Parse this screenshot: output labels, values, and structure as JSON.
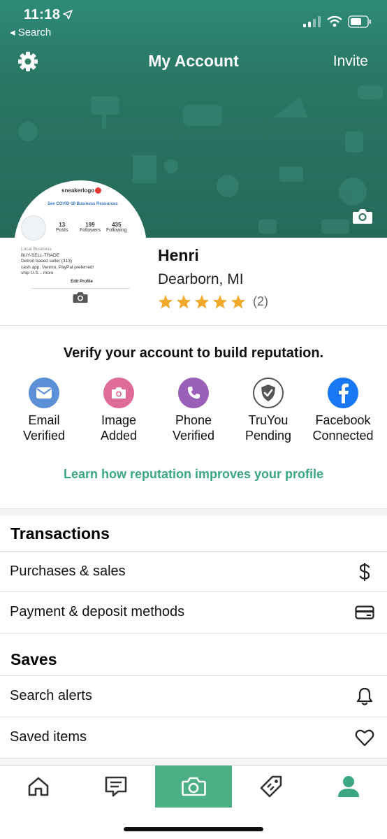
{
  "status_bar": {
    "time": "11:18",
    "back_label": "◂ Search"
  },
  "nav": {
    "title": "My Account",
    "invite_label": "Invite",
    "settings_icon": "gear-icon"
  },
  "avatar_preview": {
    "brand": "sneakerlogo",
    "link": "See COVID-19 Business Resources",
    "posts_num": "13",
    "posts_label": "Posts",
    "followers_num": "199",
    "followers_label": "Followers",
    "following_num": "435",
    "following_label": "Following",
    "line1": "Local Business",
    "line2": "BUY-SELL-TRADE",
    "line3": "Detroit based seller (313)",
    "line4": "cash app, Venmo, PayPal preferred!",
    "line5": "ship U.S... more",
    "edit": "Edit Profile"
  },
  "profile": {
    "name": "Henri",
    "location": "Dearborn, MI",
    "rating_stars": 5,
    "rating_count": "(2)"
  },
  "verify": {
    "title": "Verify your account to build reputation.",
    "items": [
      {
        "line1": "Email",
        "line2": "Verified",
        "icon": "envelope-icon",
        "color": "#5b8fd6"
      },
      {
        "line1": "Image",
        "line2": "Added",
        "icon": "camera-icon",
        "color": "#df6b99"
      },
      {
        "line1": "Phone",
        "line2": "Verified",
        "icon": "phone-icon",
        "color": "#9a5fb8"
      },
      {
        "line1": "TruYou",
        "line2": "Pending",
        "icon": "shield-check-icon",
        "color": "#555555"
      },
      {
        "line1": "Facebook",
        "line2": "Connected",
        "icon": "facebook-icon",
        "color": "#1877f2"
      }
    ],
    "learn_link": "Learn how reputation improves your profile"
  },
  "transactions": {
    "heading": "Transactions",
    "rows": [
      {
        "label": "Purchases & sales",
        "icon": "dollar-icon"
      },
      {
        "label": "Payment & deposit methods",
        "icon": "card-icon"
      }
    ]
  },
  "saves": {
    "heading": "Saves",
    "rows": [
      {
        "label": "Search alerts",
        "icon": "bell-icon"
      },
      {
        "label": "Saved items",
        "icon": "heart-icon"
      }
    ]
  },
  "tabbar": {
    "tabs": [
      "home-icon",
      "chat-icon",
      "camera-icon",
      "tag-icon",
      "profile-icon"
    ],
    "accent": "#4caf85",
    "active_color": "#3aa683"
  },
  "colors": {
    "header": "#2a7563",
    "accent": "#3aa683",
    "star": "#f0a92b"
  }
}
